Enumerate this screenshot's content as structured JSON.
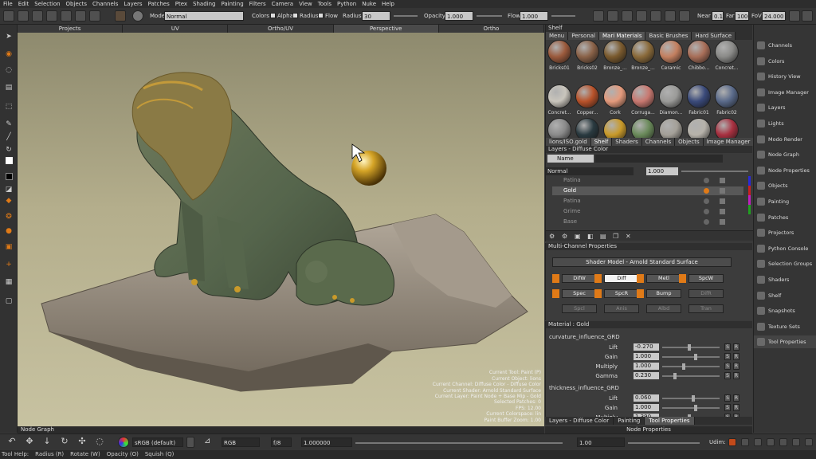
{
  "menu": [
    "File",
    "Edit",
    "Selection",
    "Objects",
    "Channels",
    "Layers",
    "Patches",
    "Ptex",
    "Shading",
    "Painting",
    "Filters",
    "Camera",
    "View",
    "Tools",
    "Python",
    "Nuke",
    "Help"
  ],
  "toolbar": {
    "mode_label": "Mode",
    "mode_value": "Normal",
    "colors_label": "Colors",
    "alpha_label": "Alpha",
    "radius_chk_label": "Radius",
    "flow_chk_label": "Flow",
    "radius_label": "Radius",
    "radius_value": "30",
    "opacity_label": "Opacity",
    "opacity_value": "1.000",
    "flow_label": "Flow",
    "flow_value": "1.000",
    "near_label": "Near",
    "near_value": "0.1",
    "far_label": "Far",
    "far_value": "1000",
    "fov_label": "FoV",
    "fov_value": "24.000"
  },
  "viewport_tabs": [
    "Projects",
    "UV",
    "Ortho/UV",
    "Perspective",
    "Ortho"
  ],
  "viewport_active_tab": "Perspective",
  "hud": [
    "Current Tool: Paint (P)",
    "Current Object: lions",
    "Current Channel: Diffuse Color - Diffuse Color",
    "Current Shader: Arnold Standard Surface",
    "Current Layer: Paint Node + Base Mip - Gold",
    "Selected Patches: 0",
    "FPS: 12.00",
    "Current Colorspace: lin",
    "Paint Buffer Zoom: 1.00"
  ],
  "shelf": {
    "title": "Shelf",
    "tabs": [
      "Menu",
      "Personal",
      "Mari Materials",
      "Basic Brushes",
      "Hard Surface"
    ],
    "active_tab": "Mari Materials",
    "swatches": [
      {
        "name": "Bricks01",
        "color": "#9b5a3c"
      },
      {
        "name": "Bricks02",
        "color": "#8a6248"
      },
      {
        "name": "Bronze_...",
        "color": "#7a5a2e"
      },
      {
        "name": "Bronze_...",
        "color": "#8a6a3a"
      },
      {
        "name": "Ceramic",
        "color": "#c48060"
      },
      {
        "name": "Chibbo...",
        "color": "#a86e58"
      },
      {
        "name": "Concret...",
        "color": "#8a8a88"
      },
      {
        "name": "Concret...",
        "color": "#c9c5bc"
      },
      {
        "name": "Copper...",
        "color": "#b8522a"
      },
      {
        "name": "Cork",
        "color": "#e49a7c"
      },
      {
        "name": "Corruga...",
        "color": "#c87870"
      },
      {
        "name": "Diamon...",
        "color": "#9a9a98"
      },
      {
        "name": "Fabric01",
        "color": "#3a4a7a"
      },
      {
        "name": "Fabric02",
        "color": "#5a6a8a"
      },
      {
        "name": "Facade01",
        "color": "#8a8a8a"
      },
      {
        "name": "Facade02",
        "color": "#2a3a40"
      },
      {
        "name": "Gold_M...",
        "color": "#c99a2a"
      },
      {
        "name": "Green_...",
        "color": "#6a8a5a"
      },
      {
        "name": "Ground01",
        "color": "#a4a098"
      },
      {
        "name": "Ground02",
        "color": "#b6b2aa"
      },
      {
        "name": "Leather01",
        "color": "#a83040"
      }
    ],
    "bottom_tabs": [
      "lions/ISO.gold",
      "Shelf",
      "Shaders",
      "Channels",
      "Objects",
      "Image Manager"
    ],
    "bottom_active": "Shelf"
  },
  "layers": {
    "title": "Layers - Diffuse Color",
    "filter_label": "Name",
    "blend_mode": "Normal",
    "opacity": "1.000",
    "rows": [
      {
        "name": "Patina",
        "selected": false
      },
      {
        "name": "Gold",
        "selected": true
      },
      {
        "name": "Patina",
        "selected": false
      },
      {
        "name": "Grime",
        "selected": false
      },
      {
        "name": "Base",
        "selected": false
      }
    ]
  },
  "mcp": {
    "title": "Multi-Channel Properties",
    "shader_label": "Shader Model - Arnold Standard Surface",
    "channels": [
      {
        "label": "DifW",
        "state": "on"
      },
      {
        "label": "Diff",
        "state": "white"
      },
      {
        "label": "Metl",
        "state": "on"
      },
      {
        "label": "SpcW",
        "state": "on"
      },
      {
        "label": "Spec",
        "state": "on"
      },
      {
        "label": "SpcR",
        "state": "on"
      },
      {
        "label": "Bump",
        "state": "on"
      },
      {
        "label": "DifR",
        "state": "dim"
      },
      {
        "label": "Spcl",
        "state": "dim"
      },
      {
        "label": "Anis",
        "state": "dim"
      },
      {
        "label": "Albd",
        "state": "dim"
      },
      {
        "label": "Tran",
        "state": "dim"
      }
    ]
  },
  "material": {
    "title": "Material : Gold",
    "groups": [
      {
        "name": "curvature_influence_GRD",
        "params": [
          {
            "label": "Lift",
            "value": "-0.270",
            "level": 0.45
          },
          {
            "label": "Gain",
            "value": "1.000",
            "level": 0.55
          },
          {
            "label": "Multiply",
            "value": "1.000",
            "level": 0.35
          },
          {
            "label": "Gamma",
            "value": "0.230",
            "level": 0.2
          }
        ]
      },
      {
        "name": "thickness_influence_GRD",
        "params": [
          {
            "label": "Lift",
            "value": "0.060",
            "level": 0.52
          },
          {
            "label": "Gain",
            "value": "1.000",
            "level": 0.55
          },
          {
            "label": "Multiply",
            "value": "1.390",
            "level": 0.45
          }
        ]
      }
    ],
    "bottom_tabs": [
      "Layers - Diffuse Color",
      "Painting",
      "Tool Properties"
    ],
    "bottom_active": "Tool Properties"
  },
  "right_panel": [
    "Channels",
    "Colors",
    "History View",
    "Image Manager",
    "Layers",
    "Lights",
    "Modo Render",
    "Node Graph",
    "Node Properties",
    "Objects",
    "Painting",
    "Patches",
    "Projectors",
    "Python Console",
    "Selection Groups",
    "Shaders",
    "Shelf",
    "Snapshots",
    "Texture Sets",
    "Tool Properties"
  ],
  "right_highlight": "Tool Properties",
  "node_graph_label": "Node Graph",
  "node_properties_label": "Node Properties",
  "bottom": {
    "colorspace": "sRGB (default)",
    "rgb": "RGB",
    "fstop": "f/8",
    "gain": "1.000000",
    "exposure": "1.00",
    "udim_label": "Udim:"
  },
  "status": {
    "tool_help": "Tool Help:",
    "items": [
      "Radius (R)",
      "Rotate (W)",
      "Opacity (O)",
      "Squish (Q)"
    ]
  }
}
